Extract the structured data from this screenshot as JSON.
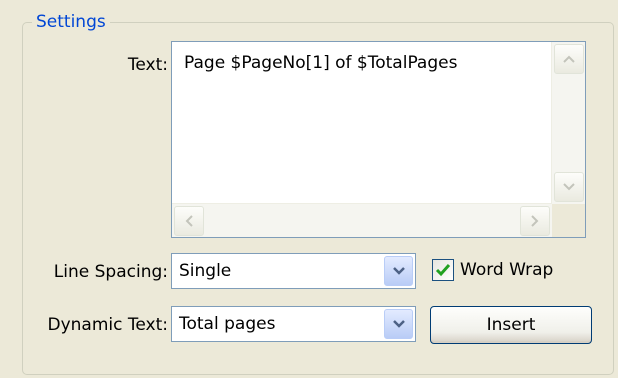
{
  "settings": {
    "group_title": "Settings",
    "text_label": "Text:",
    "text_value": "Page $PageNo[1] of $TotalPages",
    "line_spacing_label": "Line Spacing:",
    "line_spacing_value": "Single",
    "word_wrap_label": "Word Wrap",
    "word_wrap_checked": true,
    "dynamic_text_label": "Dynamic Text:",
    "dynamic_text_value": "Total pages",
    "insert_label": "Insert"
  },
  "colors": {
    "background": "#ece9d8",
    "group_title": "#0046d5",
    "check_mark": "#21a121",
    "field_border": "#7f9db9"
  }
}
